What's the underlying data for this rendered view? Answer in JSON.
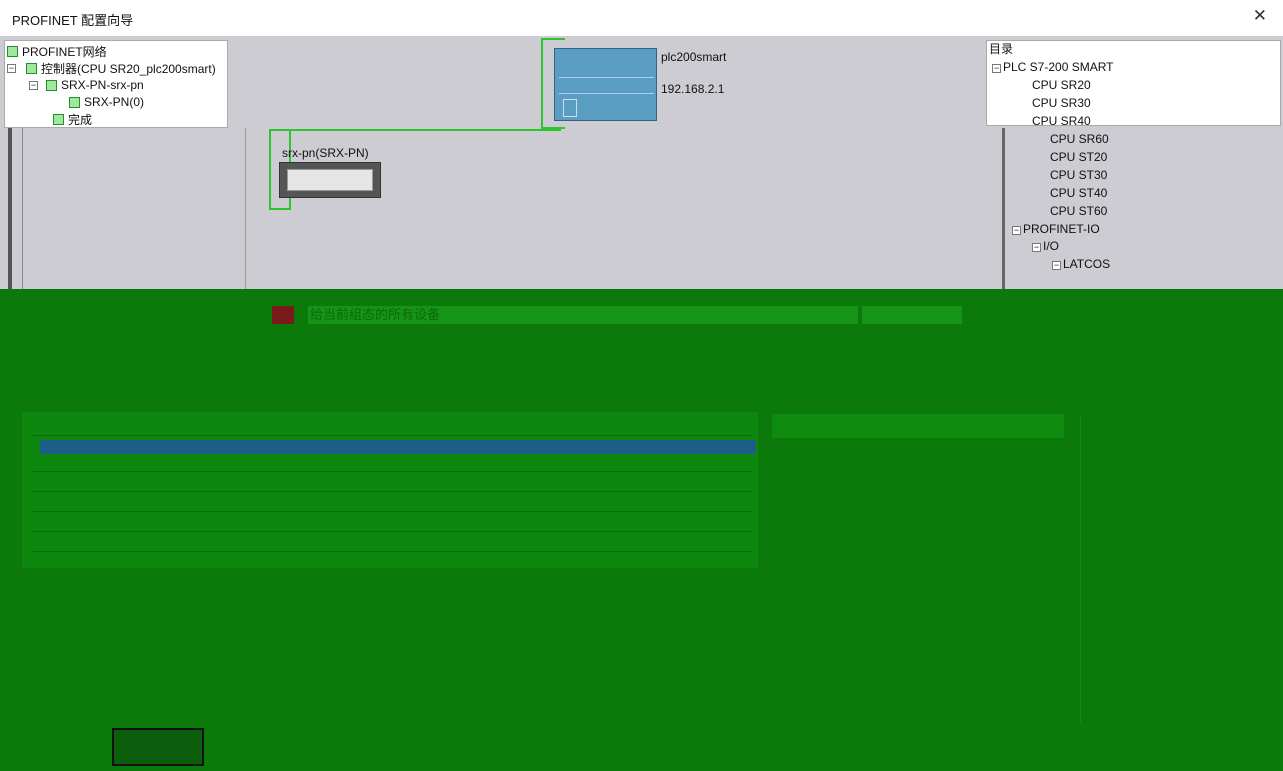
{
  "window": {
    "title": "PROFINET 配置向导",
    "close_glyph": "✕"
  },
  "network_tree": {
    "root": "PROFINET网络",
    "controller": "控制器(CPU SR20_plc200smart)",
    "device": "SRX-PN-srx-pn",
    "submodule": "SRX-PN(0)",
    "complete": "完成"
  },
  "plc": {
    "name": "plc200smart",
    "ip": "192.168.2.1"
  },
  "slave": {
    "name": "srx-pn(SRX-PN)"
  },
  "catalog": {
    "title": "目录",
    "family": "PLC S7-200 SMART",
    "cpus": [
      "CPU SR20",
      "CPU SR30",
      "CPU SR40",
      "CPU SR60",
      "CPU ST20",
      "CPU ST30",
      "CPU ST40",
      "CPU ST60"
    ],
    "profinet": "PROFINET-IO",
    "io": "I/O",
    "vendor": "LATCOS"
  },
  "hint": {
    "text": "给当前组态的所有设备"
  },
  "colors": {
    "wire": "#2ec42e",
    "device": "#5b9ec4",
    "overlay": "#0b7a0b"
  }
}
